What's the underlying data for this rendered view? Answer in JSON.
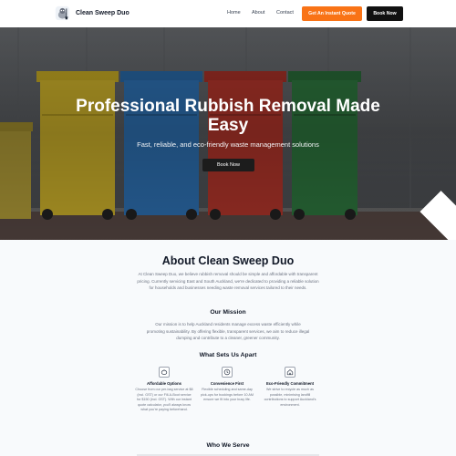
{
  "brand": {
    "name": "Clean Sweep Duo",
    "logo_icon": "cleaning-mascot-icon"
  },
  "nav": {
    "links": [
      "Home",
      "About",
      "Contact"
    ],
    "quote_button": "Get An Instant Quote",
    "book_button": "Book Now"
  },
  "hero": {
    "title": "Professional Rubbish Removal Made Easy",
    "subtitle": "Fast, reliable, and eco-friendly waste management solutions",
    "button_label": "Book Now",
    "button_icon": "arrow-right-icon",
    "image_subject": "wheelie bins",
    "bin_colors": [
      "#d4b72c",
      "#2f74b8",
      "#b8372c",
      "#2f7a40"
    ]
  },
  "about": {
    "title": "About Clean Sweep Duo",
    "intro": "At Clean Sweep Duo, we believe rubbish removal should be simple and affordable with transparent pricing. Currently servicing East and South Auckland, we're dedicated to providing a reliable solution for households and businesses needing waste removal services tailored to their needs.",
    "mission_title": "Our Mission",
    "mission_text": "Our mission is to help Auckland residents manage excess waste efficiently while promoting sustainability. By offering flexible, transparent services, we aim to reduce illegal dumping and contribute to a cleaner, greener community.",
    "apart_title": "What Sets Us Apart",
    "features": [
      {
        "icon": "piggy-bank-icon",
        "title": "Affordable Options",
        "text": "Choose from our per-bag service at $8 (incl. GST) or our Fill-A-Boot service for $150 (incl. GST). With our instant quote calculator, you'll always know what you're paying beforehand."
      },
      {
        "icon": "clock-icon",
        "title": "Convenience First",
        "text": "Flexible scheduling and same-day pick-ups for bookings before 10 AM ensure we fit into your busy life."
      },
      {
        "icon": "recycle-home-icon",
        "title": "Eco-Friendly Commitment",
        "text": "We strive to recycle as much as possible, minimising landfill contributions to support Auckland's environment."
      }
    ],
    "serve_title": "Who We Serve"
  }
}
